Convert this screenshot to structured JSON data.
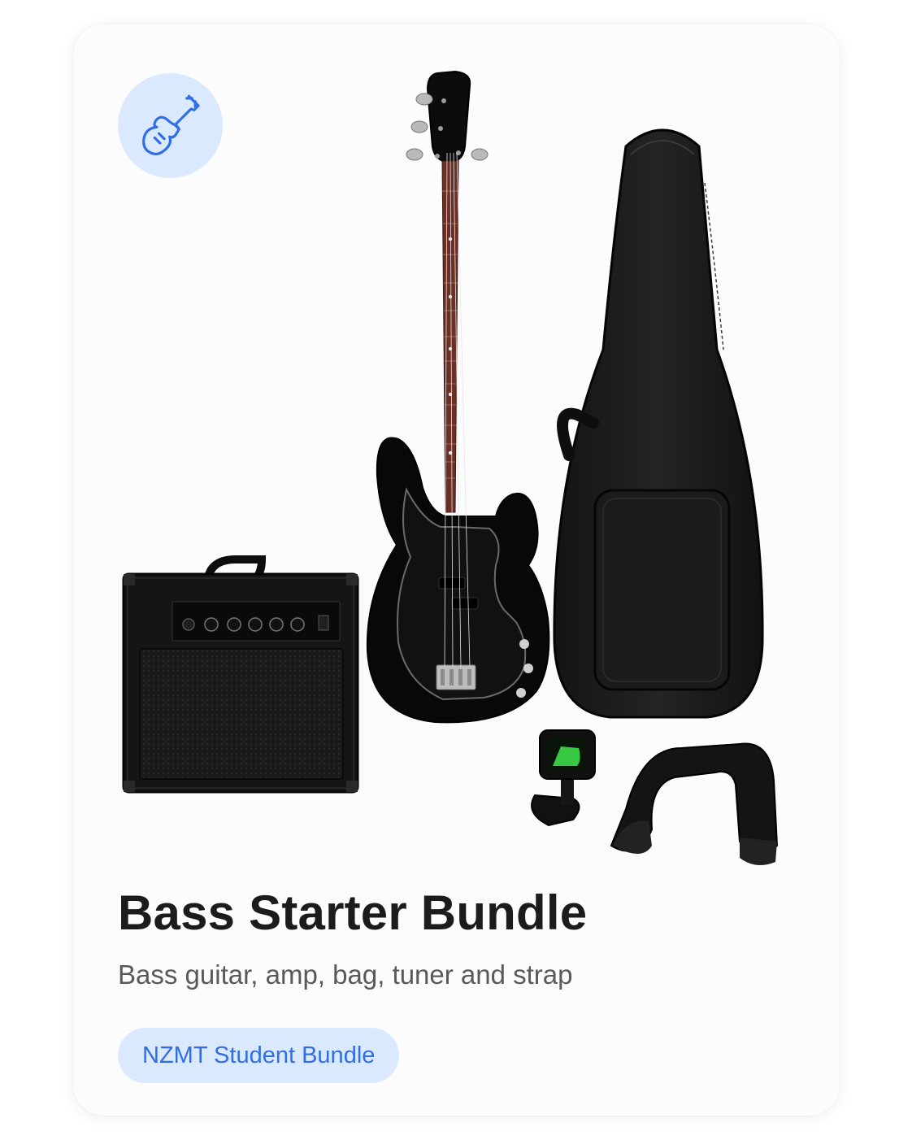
{
  "product": {
    "category_icon": "bass-guitar-icon",
    "title": "Bass Starter Bundle",
    "subtitle": "Bass guitar, amp, bag, tuner and strap",
    "tag": "NZMT Student Bundle",
    "images": [
      "bass-guitar",
      "amplifier",
      "gig-bag",
      "clip-tuner",
      "strap"
    ]
  },
  "colors": {
    "accent": "#2f6ee8",
    "accent_bg": "#dbe9ff",
    "title": "#1c1c1c",
    "subtitle": "#595959",
    "card_bg": "#fcfcfc",
    "fretboard": "#6b2f26"
  }
}
